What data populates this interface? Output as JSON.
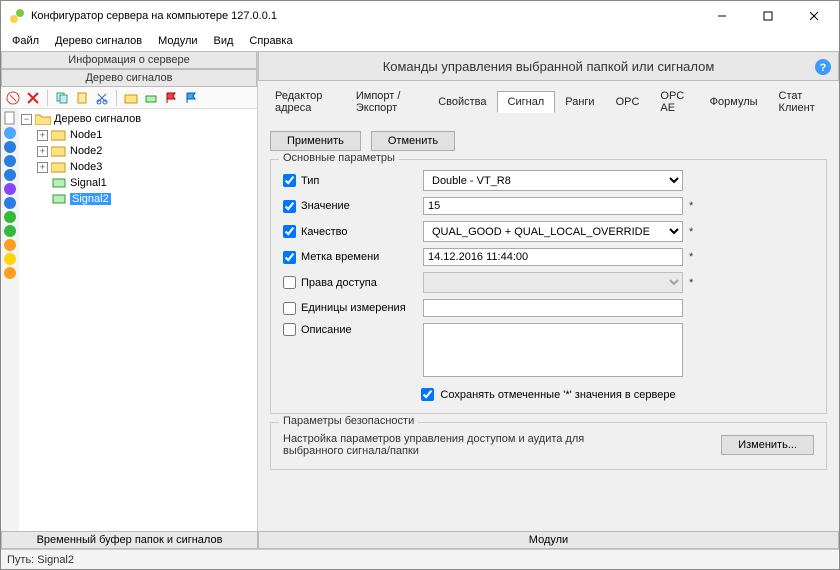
{
  "window": {
    "title": "Конфигуратор сервера на компьютере 127.0.0.1"
  },
  "menu": {
    "file": "Файл",
    "tree": "Дерево сигналов",
    "modules": "Модули",
    "view": "Вид",
    "help": "Справка"
  },
  "panels": {
    "server_info": "Информация о сервере",
    "signal_tree": "Дерево сигналов",
    "temp_buffer": "Временный буфер папок и сигналов",
    "modules": "Модули"
  },
  "tree": {
    "root": "Дерево сигналов",
    "n1": "Node1",
    "n2": "Node2",
    "n3": "Node3",
    "s1": "Signal1",
    "s2": "Signal2"
  },
  "cmd_header": "Команды управления выбранной папкой или сигналом",
  "tabs": {
    "addr": "Редактор адреса",
    "impexp": "Импорт / Экспорт",
    "props": "Свойства",
    "signal": "Сигнал",
    "ranges": "Ранги",
    "opc": "OPC",
    "opcae": "OPC AE",
    "formulas": "Формулы",
    "stat": "Стат Клиент"
  },
  "buttons": {
    "apply": "Применить",
    "cancel": "Отменить",
    "change": "Изменить..."
  },
  "group_main": "Основные параметры",
  "group_sec": "Параметры безопасности",
  "fields": {
    "type_lbl": "Тип",
    "type_val": "Double - VT_R8",
    "value_lbl": "Значение",
    "value_val": "15",
    "quality_lbl": "Качество",
    "quality_val": "QUAL_GOOD + QUAL_LOCAL_OVERRIDE",
    "ts_lbl": "Метка времени",
    "ts_val": "14.12.2016 11:44:00",
    "access_lbl": "Права доступа",
    "units_lbl": "Единицы измерения",
    "desc_lbl": "Описание",
    "save_lbl": "Сохранять отмеченные '*' значения в сервере",
    "sec_text": "Настройка параметров управления доступом и аудита для выбранного сигнала/папки"
  },
  "status": {
    "path_label": "Путь:",
    "path_value": "Signal2"
  },
  "asterisk": "*",
  "side_colors": [
    "#4aa8ff",
    "#2a7de1",
    "#2a7de1",
    "#2a7de1",
    "#8847ff",
    "#2a7de1",
    "#35b93a",
    "#35b93a",
    "#ff9f1c",
    "#ffd400",
    "#ff9f1c"
  ]
}
